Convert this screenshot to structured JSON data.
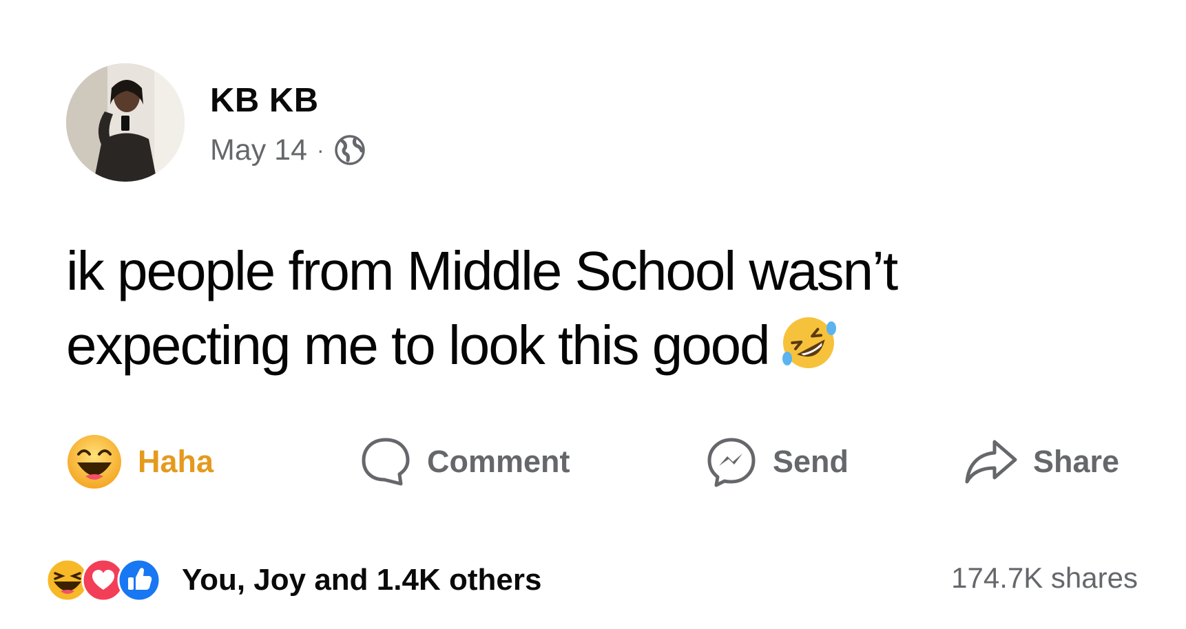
{
  "post": {
    "author": "KB KB",
    "date": "May 14",
    "separator": "·",
    "privacy_icon": "globe-icon",
    "text_line1": "ik people from Middle School wasn’t",
    "text_line2": "expecting me to look this good"
  },
  "actions": {
    "reaction_label": "Haha",
    "comment_label": "Comment",
    "send_label": "Send",
    "share_label": "Share"
  },
  "summary": {
    "reactions_text": "You, Joy and 1.4K others",
    "shares_text": "174.7K shares",
    "reaction_icons": [
      "haha-icon",
      "love-icon",
      "like-icon"
    ]
  },
  "colors": {
    "haha_accent": "#e59a1d",
    "muted": "#65676b",
    "like_blue": "#1877f2",
    "love_red": "#f33e58"
  }
}
